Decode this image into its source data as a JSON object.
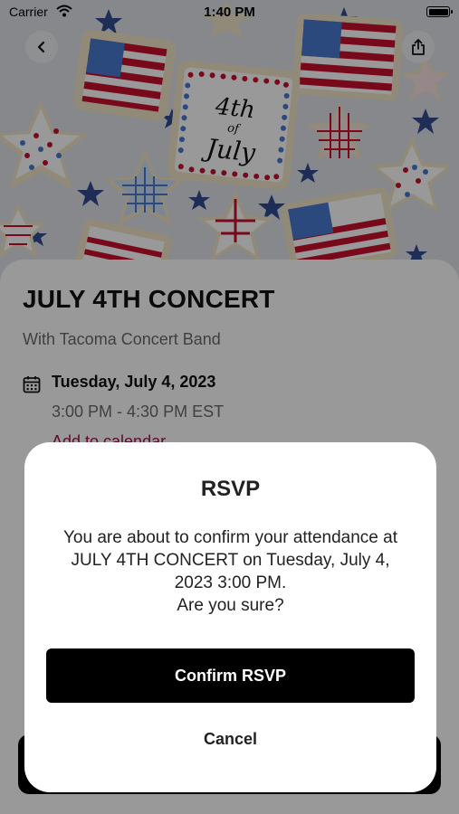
{
  "status_bar": {
    "carrier": "Carrier",
    "time": "1:40 PM",
    "icons": [
      "wifi-icon",
      "battery-icon"
    ]
  },
  "hero": {
    "image_text": "4th of July",
    "colors": {
      "red": "#c8102e",
      "blue": "#1f3c88",
      "cookie": "#f4e6c8",
      "background": "#dfe3ea"
    }
  },
  "nav": {
    "back_icon": "chevron-left-icon",
    "share_icon": "share-icon"
  },
  "event": {
    "title": "JULY 4TH CONCERT",
    "subtitle": "With Tacoma Concert Band",
    "date_icon": "calendar-icon",
    "date": "Tuesday, July 4, 2023",
    "time_range": "3:00 PM - 4:30 PM EST",
    "add_to_calendar": "Add to calendar",
    "accent_color": "#a0144f"
  },
  "dialog": {
    "title": "RSVP",
    "message_line1": "You are about to confirm your attendance at",
    "message_line2": "JULY 4TH CONCERT on Tuesday, July 4,",
    "message_line3": "2023 3:00 PM.",
    "message_line4": "Are you sure?",
    "confirm_label": "Confirm RSVP",
    "cancel_label": "Cancel"
  }
}
